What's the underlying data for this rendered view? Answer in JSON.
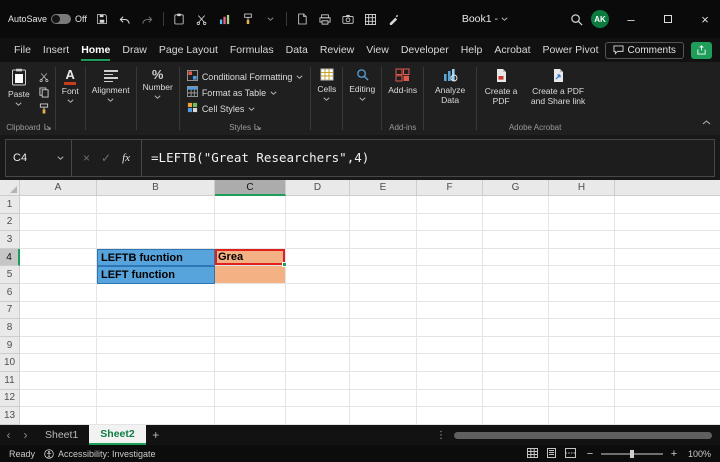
{
  "colors": {
    "accent_green": "#1F9D5B",
    "tab_green": "#0F7C43",
    "cell_blue": "#57A3DB",
    "cell_blue_border": "#2E75B6",
    "cell_orange": "#F4B183",
    "cell_red": "#E0201C"
  },
  "titlebar": {
    "autosave_label": "AutoSave",
    "autosave_state": "Off",
    "title": "Book1 -",
    "avatar": "AK"
  },
  "menubar": {
    "items": [
      "File",
      "Insert",
      "Home",
      "Draw",
      "Page Layout",
      "Formulas",
      "Data",
      "Review",
      "View",
      "Developer",
      "Help",
      "Acrobat",
      "Power Pivot"
    ],
    "active": "Home",
    "comments_label": "Comments"
  },
  "ribbon": {
    "paste_label": "Paste",
    "clipboard_group_label": "Clipboard",
    "font_label": "Font",
    "alignment_label": "Alignment",
    "number_label": "Number",
    "styles": [
      "Conditional Formatting",
      "Format as Table",
      "Cell Styles"
    ],
    "styles_group_label": "Styles",
    "cells_label": "Cells",
    "editing_label": "Editing",
    "addins_label": "Add-ins",
    "addins_group_label": "Add-ins",
    "analyze_label": "Analyze Data",
    "acrobat_buttons": [
      "Create a PDF",
      "Create a PDF and Share link"
    ],
    "acrobat_group_label": "Adobe Acrobat"
  },
  "formulabar": {
    "name_box": "C4",
    "fx_label": "fx",
    "formula": "=LEFTB(\"Great Researchers\",4)"
  },
  "grid": {
    "columns": [
      "A",
      "B",
      "C",
      "D",
      "E",
      "F",
      "G",
      "H"
    ],
    "selected_column": "C",
    "rows": [
      "1",
      "2",
      "3",
      "4",
      "5",
      "6",
      "7",
      "8",
      "9",
      "10",
      "11",
      "12",
      "13"
    ],
    "selected_row": "4",
    "cells": [
      {
        "ref": "B4",
        "text": "LEFTB fucntion",
        "fill": "blue"
      },
      {
        "ref": "B5",
        "text": "LEFT function",
        "fill": "blue"
      },
      {
        "ref": "C4",
        "text": "Grea",
        "fill": "orange",
        "selected": true,
        "red_border": true
      },
      {
        "ref": "C5",
        "text": "",
        "fill": "orange"
      }
    ]
  },
  "sheetbar": {
    "tabs": [
      "Sheet1",
      "Sheet2"
    ],
    "active": "Sheet2"
  },
  "statusbar": {
    "ready_label": "Ready",
    "accessibility_label": "Accessibility: Investigate",
    "zoom_level": "100%"
  },
  "icons": {
    "minimize": "–",
    "close": "×",
    "cancel": "×",
    "check": "✓",
    "percent": "%",
    "font_a": "A",
    "plus": "+",
    "minus": "−",
    "ellipsis": "⋮",
    "tab_prev": "‹",
    "tab_next": "›",
    "add": "+"
  }
}
